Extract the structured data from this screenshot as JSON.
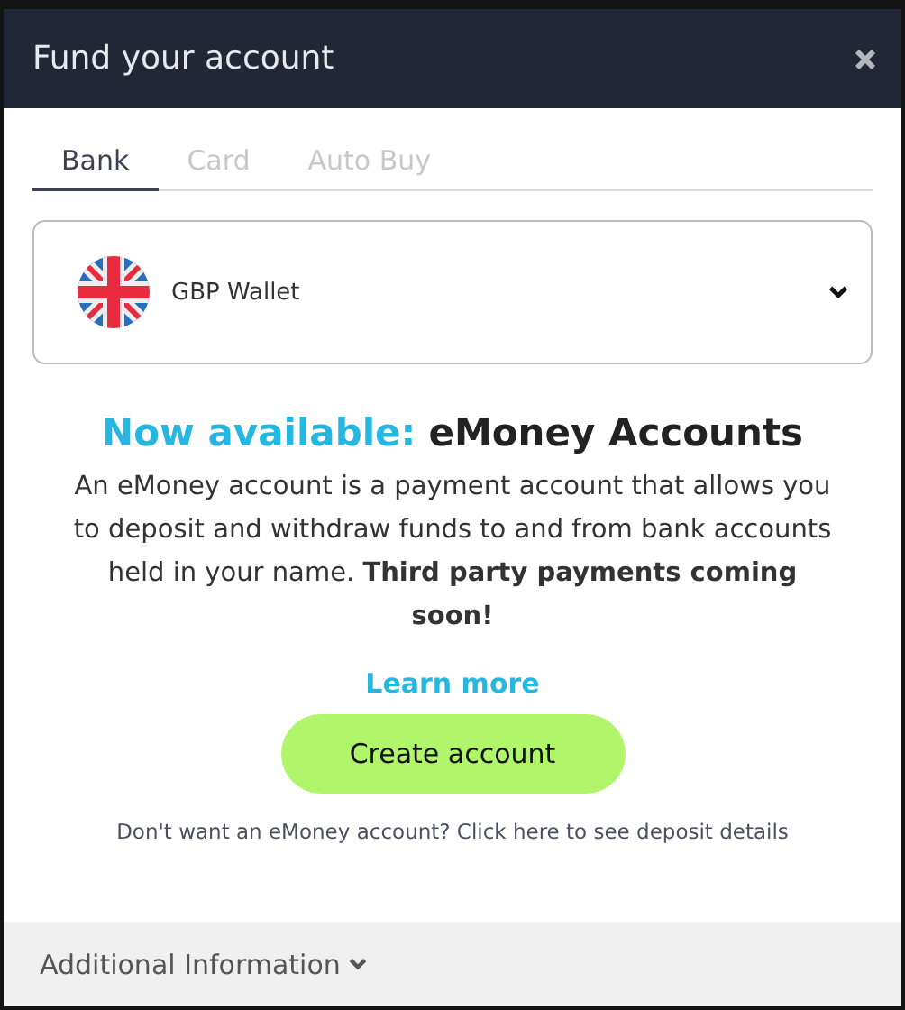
{
  "window": {
    "title": "Fund your account"
  },
  "tabs": [
    {
      "label": "Bank",
      "selected": true
    },
    {
      "label": "Card",
      "selected": false
    },
    {
      "label": "Auto Buy",
      "selected": false
    }
  ],
  "wallet_select": {
    "value": "GBP Wallet"
  },
  "headline": {
    "prefix": "Now available:",
    "title": "eMoney Accounts"
  },
  "description": "An eMoney account is a payment account that allows you to deposit and withdraw funds to and from bank accounts held in your name. **Third party payments coming soon!**",
  "learn_more": "Learn more",
  "create_button": "Create account",
  "deposit_link": "Don't want an eMoney account? Click here to see deposit details",
  "footer": {
    "label": "Additional Information"
  }
}
